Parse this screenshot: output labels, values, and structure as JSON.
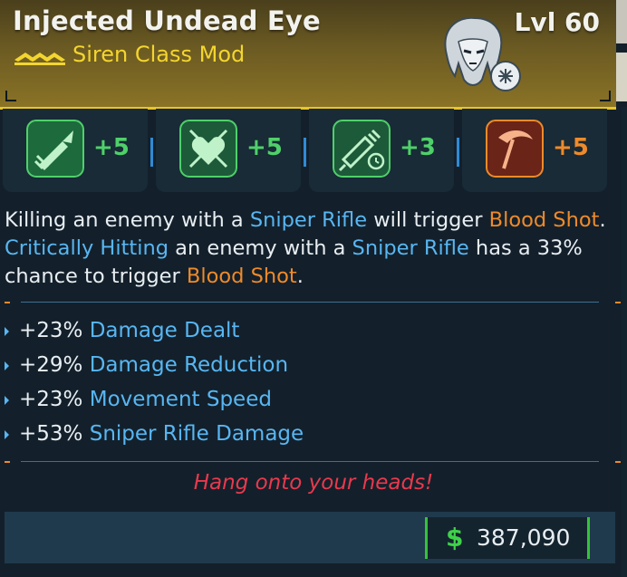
{
  "item": {
    "name": "Injected Undead Eye",
    "level": "Lvl 60",
    "type": "Siren Class Mod",
    "rarity_icon": "rarity-chevrons-icon",
    "portrait_icon": "siren-portrait-icon"
  },
  "skills": [
    {
      "icon": "sniper-dart-icon",
      "value": "+5",
      "color": "#4fd06a"
    },
    {
      "icon": "crossed-heart-icon",
      "value": "+5",
      "color": "#4fd06a"
    },
    {
      "icon": "syringe-timer-icon",
      "value": "+3",
      "color": "#4fd06a"
    },
    {
      "icon": "scythe-icon",
      "value": "+5",
      "color": "#ef8a2a"
    }
  ],
  "description": {
    "p1": "Killing an enemy with a ",
    "k1": "Sniper Rifle",
    "p2": " will trigger ",
    "k2": "Blood Shot",
    "p3": ". ",
    "k3": "Critically Hitting",
    "p4": " an enemy with a ",
    "k4": "Sniper Rifle",
    "p5": " has a 33% chance to trigger ",
    "k5": "Blood Shot",
    "p6": "."
  },
  "stats": [
    {
      "pct": "+23%",
      "name": "Damage Dealt"
    },
    {
      "pct": "+29%",
      "name": "Damage Reduction"
    },
    {
      "pct": "+23%",
      "name": "Movement Speed"
    },
    {
      "pct": "+53%",
      "name": "Sniper Rifle Damage"
    }
  ],
  "flavor": "Hang onto your heads!",
  "price": {
    "symbol": "$",
    "amount": "387,090"
  },
  "colors": {
    "accent_gold": "#e8c52a",
    "keyword_blue": "#58b6f2",
    "keyword_orange": "#ef8a2a",
    "flavor_red": "#e8394d",
    "money_green": "#35c23a"
  }
}
